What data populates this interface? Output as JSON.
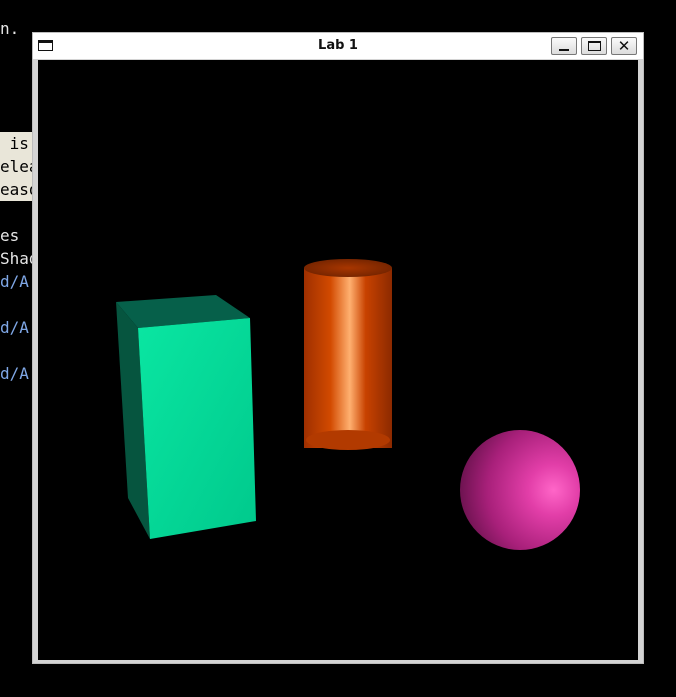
{
  "terminal": {
    "lines": [
      {
        "text": "n."
      },
      {
        "text": " is"
      },
      {
        "text": "elea"
      },
      {
        "text": "easo"
      },
      {
        "text": "es "
      },
      {
        "text": "Shad"
      },
      {
        "text": "d/A"
      },
      {
        "text": "d/A"
      },
      {
        "text": "d/A"
      }
    ]
  },
  "window": {
    "title": "Lab 1",
    "buttons": {
      "minimize": "minimize",
      "maximize": "maximize",
      "close": "✕"
    }
  },
  "scene": {
    "background": "#000000",
    "objects": [
      {
        "name": "box",
        "color": "#00e6a0"
      },
      {
        "name": "cylinder",
        "color": "#d24a00"
      },
      {
        "name": "sphere",
        "color": "#e040b0"
      }
    ]
  }
}
